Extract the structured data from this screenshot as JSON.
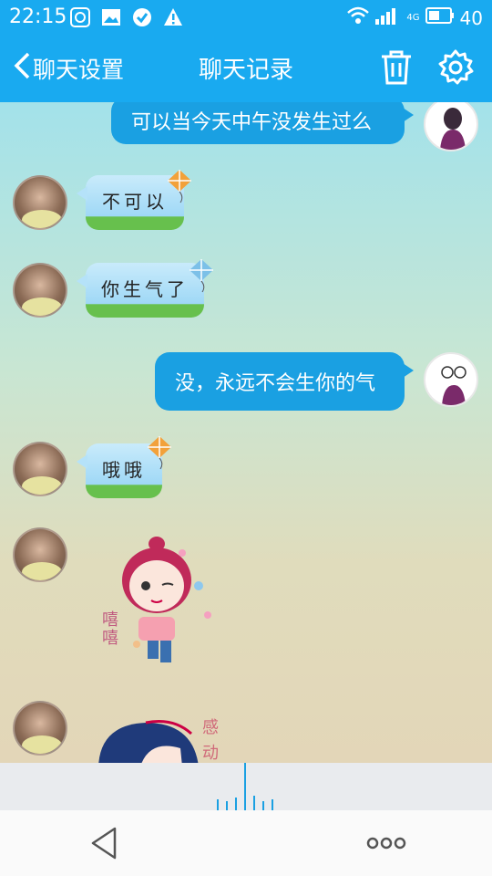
{
  "status_bar": {
    "time": "22:15",
    "network": "4G",
    "battery": "40",
    "icons": [
      "app-notification-icon",
      "image-icon",
      "check-circle-icon",
      "warning-icon",
      "wifi-icon",
      "signal-icon",
      "battery-icon"
    ]
  },
  "header": {
    "back_label": "聊天设置",
    "title": "聊天记录",
    "icons": [
      "trash-icon",
      "gear-icon"
    ]
  },
  "messages": [
    {
      "side": "right",
      "text": "可以当今天中午没发生过么"
    },
    {
      "side": "left",
      "text": "不可以"
    },
    {
      "side": "left",
      "text": "你生气了"
    },
    {
      "side": "right",
      "text": "没，永远不会生你的气"
    },
    {
      "side": "left",
      "text": "哦哦"
    },
    {
      "side": "left",
      "type": "sticker",
      "text": "嘻嘻"
    },
    {
      "side": "left",
      "type": "sticker",
      "text": "感动"
    }
  ],
  "colors": {
    "header_bg": "#19aaf0",
    "outgoing_bubble": "#1aa0e2",
    "incoming_bubble_top": "#c9ebfb",
    "incoming_bubble_grass": "#67c04d"
  }
}
